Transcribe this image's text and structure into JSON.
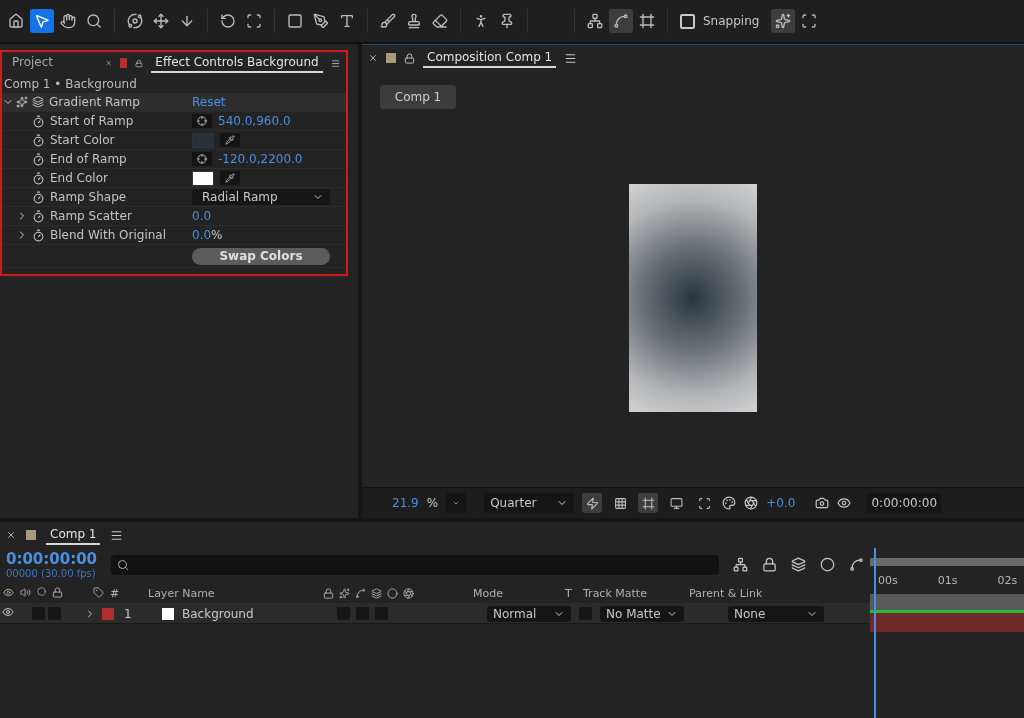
{
  "toolbar": {
    "tools": [
      {
        "kind": "home",
        "selected": false
      },
      {
        "kind": "select",
        "selected": true
      },
      {
        "kind": "hand",
        "selected": false
      },
      {
        "kind": "zoom",
        "selected": false
      },
      {
        "kind": "orbit",
        "selected": false
      },
      {
        "kind": "move",
        "selected": false
      },
      {
        "kind": "dolly",
        "selected": false
      },
      {
        "kind": "rotate",
        "selected": false
      },
      {
        "kind": "anchor",
        "selected": false
      },
      {
        "kind": "shape",
        "selected": false
      },
      {
        "kind": "pen",
        "selected": false
      },
      {
        "kind": "type",
        "selected": false
      },
      {
        "kind": "brush",
        "selected": false
      },
      {
        "kind": "stamp",
        "selected": false
      },
      {
        "kind": "eraser",
        "selected": false
      },
      {
        "kind": "puppet",
        "selected": false
      },
      {
        "kind": "pin",
        "selected": false
      }
    ],
    "axis_tools": [
      {
        "kind": "local",
        "selected": false
      },
      {
        "kind": "world",
        "selected": true
      },
      {
        "kind": "view",
        "selected": false
      }
    ],
    "snapping": {
      "label": "Snapping",
      "checked": false
    },
    "snap_tools": [
      {
        "kind": "snap-edge",
        "selected": true
      },
      {
        "kind": "snap-grid",
        "selected": false
      }
    ]
  },
  "effect_panel": {
    "tabs": [
      {
        "label": "Project",
        "selected": false
      },
      {
        "label": "Effect Controls Background",
        "selected": true
      }
    ],
    "breadcrumb": "Comp 1 • Background",
    "effect": {
      "name": "Gradient Ramp",
      "reset": "Reset",
      "expanded": true
    },
    "properties": [
      {
        "kind": "point",
        "name": "Start of Ramp",
        "value": "540.0,960.0"
      },
      {
        "kind": "color",
        "name": "Start Color",
        "color": "#27313a"
      },
      {
        "kind": "point",
        "name": "End of Ramp",
        "value": "-120.0,2200.0"
      },
      {
        "kind": "color",
        "name": "End Color",
        "color": "#ffffff"
      },
      {
        "kind": "select",
        "name": "Ramp Shape",
        "value": "Radial Ramp"
      },
      {
        "kind": "number",
        "name": "Ramp Scatter",
        "value": "0.0",
        "expanded": false
      },
      {
        "kind": "number",
        "name": "Blend With Original",
        "value": "0.0",
        "unit": "%",
        "expanded": false
      },
      {
        "kind": "button",
        "label": "Swap Colors"
      }
    ]
  },
  "composition_panel": {
    "tab": "Composition Comp 1",
    "view_tab": "Comp 1",
    "footer": {
      "zoom": "21.9",
      "zoom_unit": "%",
      "resolution": "Quarter",
      "toggles": [
        {
          "kind": "fast-preview",
          "selected": true
        },
        {
          "kind": "transparency",
          "selected": false
        },
        {
          "kind": "mask",
          "selected": true
        },
        {
          "kind": "region",
          "selected": false
        },
        {
          "kind": "guides",
          "selected": false
        }
      ],
      "exposure": "+0.0",
      "time": "0:00:00:00"
    }
  },
  "timeline": {
    "tab": "Comp 1",
    "time": "0:00:00:00",
    "frames": "00000 (30.00 fps)",
    "columns": {
      "number": "#",
      "name": "Layer Name",
      "mode": "Mode",
      "t": "T",
      "matte": "Track Matte",
      "parent": "Parent & Link"
    },
    "layers": [
      {
        "number": "1",
        "name": "Background",
        "color": "#b0302e",
        "mode": "Normal",
        "matte": "No Matte",
        "parent": "None",
        "visible": true,
        "expanded": false
      }
    ],
    "ruler": [
      "00s",
      "01s",
      "02s"
    ]
  }
}
